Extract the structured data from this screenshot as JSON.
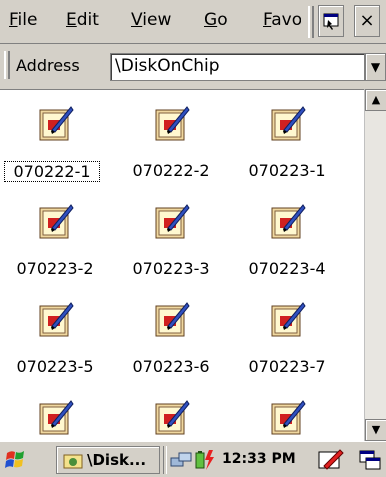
{
  "menu": {
    "file": "File",
    "edit": "Edit",
    "view": "View",
    "go": "Go",
    "favorites": "Favorites"
  },
  "toolbar": {
    "props_icon": "properties-icon",
    "close_label": "×"
  },
  "address": {
    "label": "Address",
    "value": "\\DiskOnChip",
    "dropdown_icon": "▼"
  },
  "files": [
    {
      "name": "070222-1",
      "icon": "paint-image-icon"
    },
    {
      "name": "070222-2",
      "icon": "paint-image-icon"
    },
    {
      "name": "070223-1",
      "icon": "paint-image-icon"
    },
    {
      "name": "070223-2",
      "icon": "paint-image-icon"
    },
    {
      "name": "070223-3",
      "icon": "paint-image-icon"
    },
    {
      "name": "070223-4",
      "icon": "paint-image-icon"
    },
    {
      "name": "070223-5",
      "icon": "paint-image-icon"
    },
    {
      "name": "070223-6",
      "icon": "paint-image-icon"
    },
    {
      "name": "070223-7",
      "icon": "paint-image-icon"
    },
    {
      "name": "",
      "icon": "paint-image-icon"
    },
    {
      "name": "",
      "icon": "paint-image-icon"
    },
    {
      "name": "",
      "icon": "paint-image-icon"
    }
  ],
  "scrollbar": {
    "up": "▲",
    "down": "▼"
  },
  "taskbar": {
    "task_label": "\\Disk...",
    "clock": "12:33 PM"
  }
}
